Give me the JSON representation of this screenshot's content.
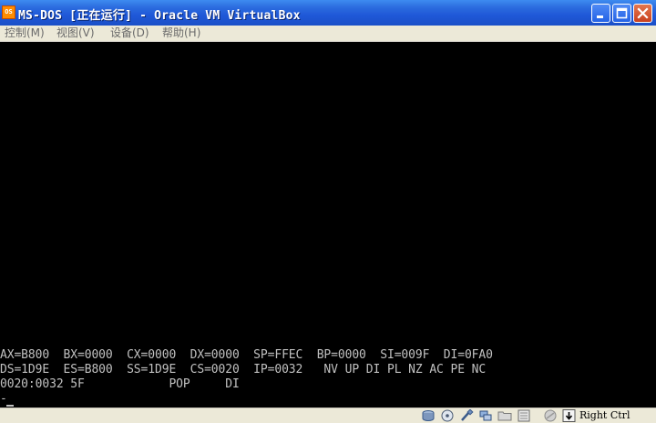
{
  "window": {
    "title": "MS-DOS [正在运行] - Oracle VM VirtualBox",
    "app_icon": "virtualbox-icon",
    "app_icon_label": "OS",
    "controls": [
      "minimize-icon",
      "maximize-icon",
      "close-icon"
    ],
    "accent_color": "#2563dd",
    "close_color": "#d1512b"
  },
  "menu": {
    "items": [
      {
        "label": "控制(M)"
      },
      {
        "label": "视图(V)"
      },
      {
        "label": "设备(D)"
      },
      {
        "label": "帮助(H)"
      }
    ]
  },
  "console": {
    "lines": [
      "AX=B800  BX=0000  CX=0000  DX=0000  SP=FFEC  BP=0000  SI=009F  DI=0FA0",
      "DS=1D9E  ES=B800  SS=1D9E  CS=0020  IP=0032   NV UP DI PL NZ AC PE NC",
      "0020:0032 5F            POP     DI",
      "-"
    ],
    "text_color": "#c0c0c0",
    "background": "#000000"
  },
  "statusbar": {
    "icons": [
      "hard-disk-icon",
      "optical-drive-icon",
      "usb-icon",
      "network-icon",
      "shared-folder-icon",
      "video-capture-icon",
      "mouse-integration-icon",
      "host-key-arrow-icon"
    ],
    "host_key": "Right Ctrl"
  }
}
